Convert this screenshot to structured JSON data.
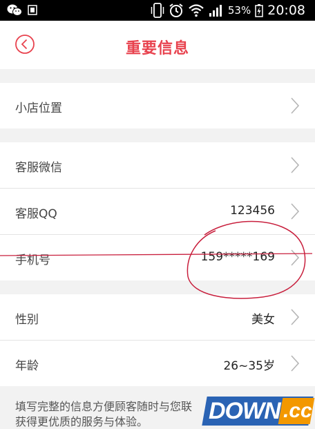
{
  "status_bar": {
    "battery_percent": "53%",
    "time": "20:08"
  },
  "header": {
    "title": "重要信息"
  },
  "rows": [
    {
      "label": "小店位置",
      "value": ""
    },
    {
      "label": "客服微信",
      "value": ""
    },
    {
      "label": "客服QQ",
      "value": "123456"
    },
    {
      "label": "手机号",
      "value": "159*****169"
    },
    {
      "label": "性别",
      "value": "美女"
    },
    {
      "label": "年龄",
      "value": "26~35岁"
    }
  ],
  "note": {
    "line1": "填写完整的信息方便顾客随时与您联",
    "line2": "获得更优质的服务与体验。"
  },
  "watermark": {
    "main": "DOWN",
    "suffix": ".cc"
  },
  "colors": {
    "accent": "#e8424e",
    "annotation": "#c81e3c"
  }
}
